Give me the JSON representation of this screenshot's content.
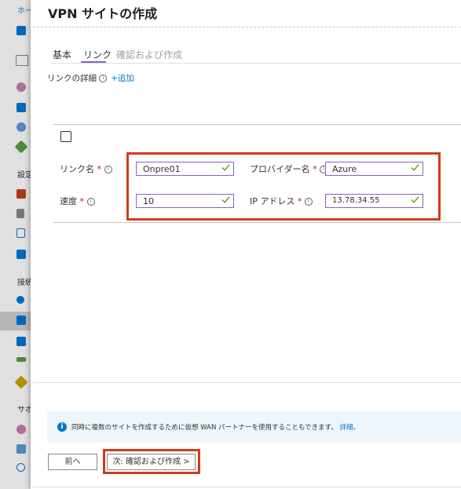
{
  "nav": {
    "home": "ホーム",
    "section_settings": "設定",
    "section_connect": "接続",
    "section_support": "サポ"
  },
  "blade": {
    "title": "VPN サイトの作成",
    "tabs": [
      {
        "label": "基本"
      },
      {
        "label": "リンク"
      },
      {
        "label": "確認および作成"
      }
    ],
    "link_details_label": "リンクの詳細",
    "add_label": "+追加"
  },
  "link_form": {
    "link_name": {
      "label": "リンク名",
      "value": "Onpre01"
    },
    "provider_name": {
      "label": "プロバイダー名",
      "value": "Azure"
    },
    "speed": {
      "label": "速度",
      "value": "10"
    },
    "ip_address": {
      "label": "IP アドレス",
      "value": "13.78.34.55"
    },
    "required_mark": "*",
    "info_glyph": "i"
  },
  "info_bar": {
    "text": "同時に複数のサイトを作成するために仮想 WAN パートナーを使用することもできます。",
    "link_text": "詳細。",
    "icon_glyph": "i"
  },
  "footer": {
    "prev_button": "前へ",
    "next_button": "次: 確認および作成 >"
  },
  "colors": {
    "accent": "#8661c5",
    "highlight": "#d13c1a",
    "link": "#0078d4"
  }
}
